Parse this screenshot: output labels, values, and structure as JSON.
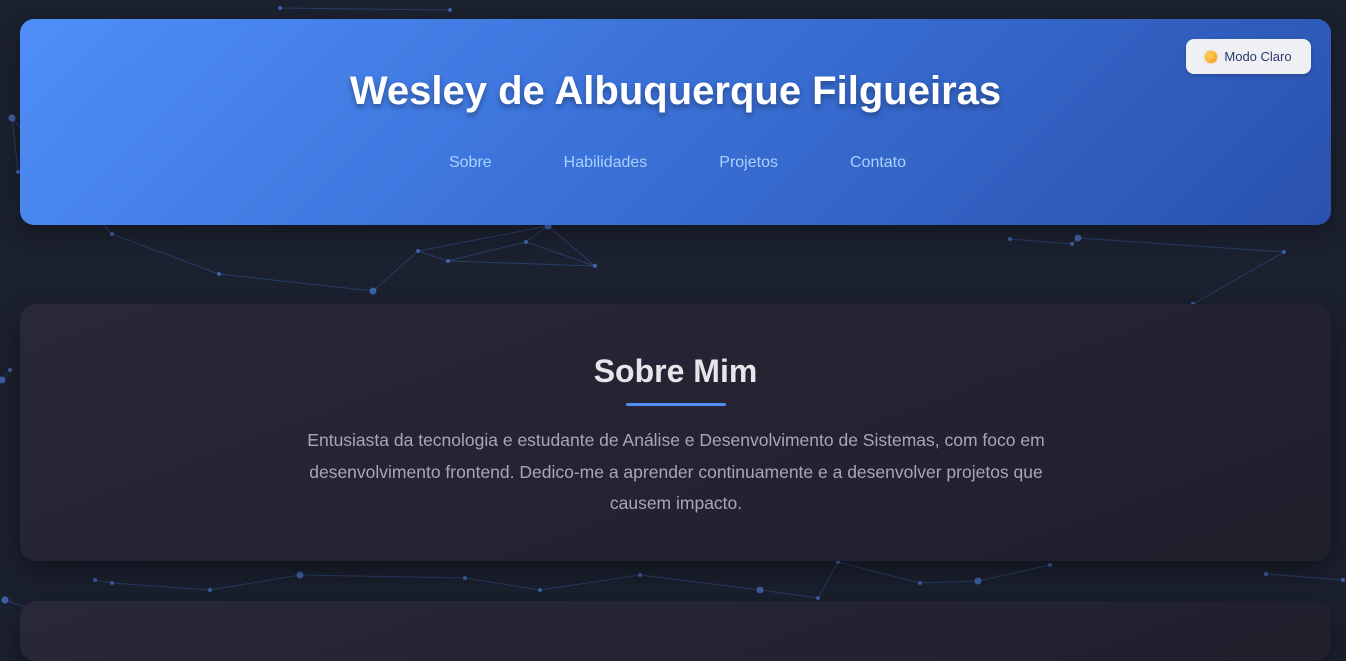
{
  "header": {
    "title": "Wesley de Albuquerque Filgueiras",
    "theme_toggle": {
      "icon": "sun-icon",
      "label": "Modo Claro"
    },
    "nav": [
      {
        "label": "Sobre"
      },
      {
        "label": "Habilidades"
      },
      {
        "label": "Projetos"
      },
      {
        "label": "Contato"
      }
    ]
  },
  "about": {
    "title": "Sobre Mim",
    "text": "Entusiasta da tecnologia e estudante de Análise e Desenvolvimento de Sistemas, com foco em desenvolvimento frontend. Dedico-me a aprender continuamente e a desenvolver projetos que causem impacto."
  },
  "colors": {
    "background": "#1c2130",
    "header_gradient_start": "#4f8ff7",
    "header_gradient_end": "#2a52ae",
    "accent": "#4f8ff7",
    "nav_link": "#a8d1ff",
    "section_bg": "#252433",
    "body_text": "#a7a8b4"
  }
}
